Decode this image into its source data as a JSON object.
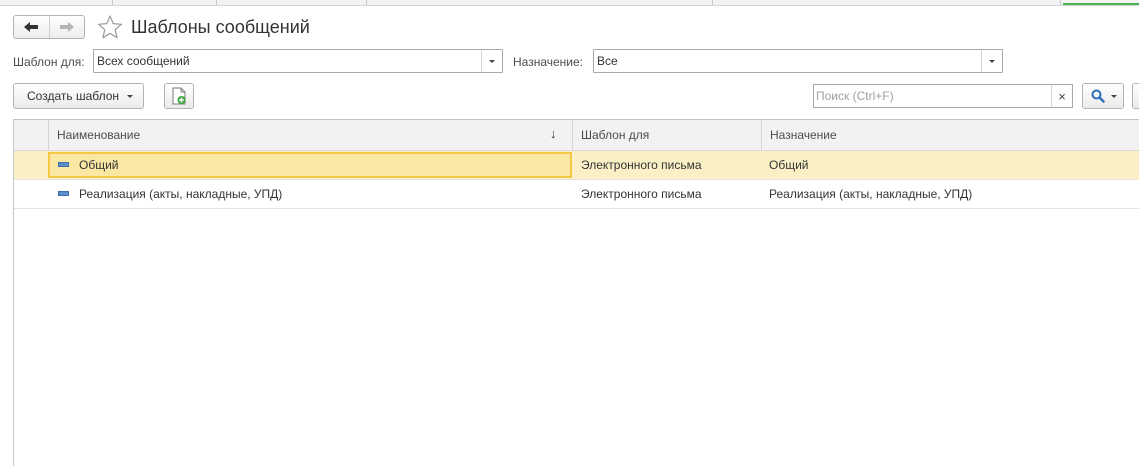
{
  "header": {
    "title": "Шаблоны сообщений"
  },
  "filters": {
    "template_for_label": "Шаблон для:",
    "template_for_value": "Всех сообщений",
    "purpose_label": "Назначение:",
    "purpose_value": "Все"
  },
  "toolbar": {
    "create_button_label": "Создать шаблон",
    "search_placeholder": "Поиск (Ctrl+F)",
    "search_clear_symbol": "×"
  },
  "table": {
    "columns": [
      "Наименование",
      "Шаблон для",
      "Назначение"
    ],
    "sort_indicator": "↓",
    "rows": [
      {
        "name": "Общий",
        "template_for": "Электронного письма",
        "purpose": "Общий",
        "selected": true
      },
      {
        "name": "Реализация (акты, накладные, УПД)",
        "template_for": "Электронного письма",
        "purpose": "Реализация (акты, накладные, УПД)",
        "selected": false
      }
    ]
  },
  "colors": {
    "selected_row": "#fbf0c5",
    "focus_border": "#f3c743",
    "accent_tab": "#4caf50",
    "search_icon": "#2a6ebb"
  }
}
